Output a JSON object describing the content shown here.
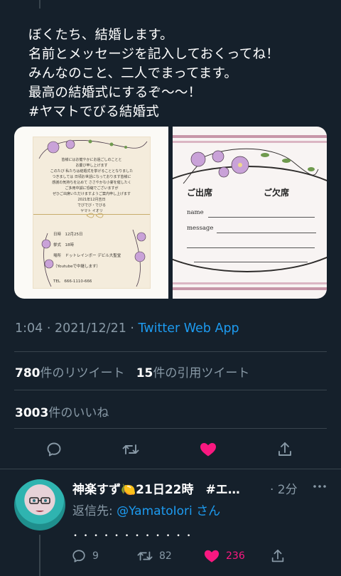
{
  "tweet": {
    "lines": [
      "ぼくたち、結婚します。",
      "名前とメッセージを記入しておくってね！",
      "みんなのこと、二人でまってます。",
      "最高の結婚式にするぞ〜〜！",
      "#ヤマトでびる結婚式"
    ],
    "media": {
      "left": {
        "letter": [
          "皆様にはお健やかにお過ごしのことと",
          "お慶び申し上げます",
          "このたび 私たちは結婚式を挙げることとなりました",
          "つきましては 日頃お世話になっております皆様に",
          "感謝の気持ちを込めて ささやかな小宴を催したく",
          "ご多用中誠に恐縮でございますが",
          "ぜひご出席いただけますようご案内申し上げます",
          "2021年12月吉日",
          "でびでび・でびる",
          "ヤマト イオリ"
        ],
        "info": [
          "日時　12月25日",
          "挙式　18時",
          "場所　ドットレインボー デビル大聖堂",
          "（Youtubeで中継します）",
          "TEL　666-1110-666"
        ]
      },
      "right": {
        "attend": "ご出席",
        "absent": "ご欠席",
        "name_label": "name",
        "message_label": "message"
      }
    },
    "timestamp": "1:04 · 2021/12/21 · ",
    "source": "Twitter Web App",
    "retweets": {
      "count": "780",
      "label": "件のリツイート"
    },
    "quotes": {
      "count": "15",
      "label": "件の引用ツイート"
    },
    "likes": {
      "count": "3003",
      "label": "件のいいね"
    }
  },
  "reply": {
    "name": "神楽すず🍋21日22時　#エ…",
    "time": "· 2分",
    "reply_to_prefix": "返信先: ",
    "reply_to_handle": "@YamatoIori",
    "reply_to_suffix": " さん",
    "body": "．．．．．．．．．．．．",
    "reply_count": "9",
    "retweet_count": "82",
    "like_count": "236"
  },
  "colors": {
    "background": "#15202b",
    "divider": "#38444d",
    "secondary_text": "#8899a6",
    "link": "#1d9bf0",
    "like": "#f91880"
  },
  "icons": [
    "reply-icon",
    "retweet-icon",
    "like-icon",
    "share-icon",
    "more-icon"
  ]
}
